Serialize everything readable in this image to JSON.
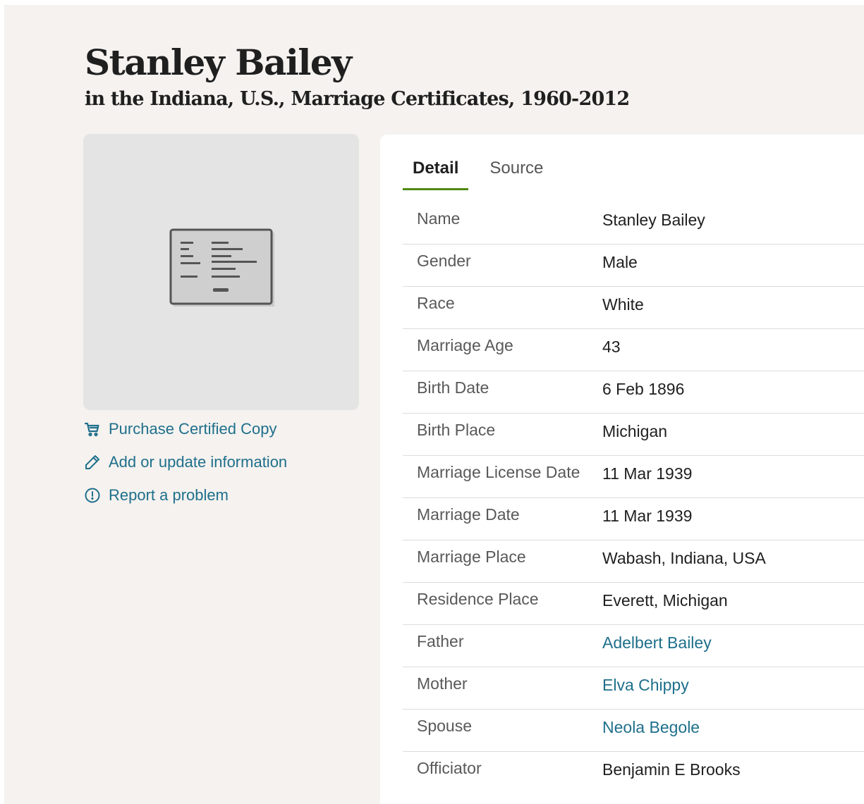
{
  "header": {
    "title": "Stanley Bailey",
    "subtitle": "in the Indiana, U.S., Marriage Certificates, 1960-2012"
  },
  "image_card": {
    "icon": "document-icon"
  },
  "actions": [
    {
      "icon": "cart-icon",
      "label": "Purchase Certified Copy"
    },
    {
      "icon": "pencil-icon",
      "label": "Add or update information"
    },
    {
      "icon": "alert-circle-icon",
      "label": "Report a problem"
    }
  ],
  "tabs": [
    {
      "label": "Detail",
      "active": true
    },
    {
      "label": "Source",
      "active": false
    }
  ],
  "details": [
    {
      "label": "Name",
      "value": "Stanley Bailey",
      "link": false
    },
    {
      "label": "Gender",
      "value": "Male",
      "link": false
    },
    {
      "label": "Race",
      "value": "White",
      "link": false
    },
    {
      "label": "Marriage Age",
      "value": "43",
      "link": false
    },
    {
      "label": "Birth Date",
      "value": "6 Feb 1896",
      "link": false
    },
    {
      "label": "Birth Place",
      "value": "Michigan",
      "link": false
    },
    {
      "label": "Marriage License Date",
      "value": "11 Mar 1939",
      "link": false
    },
    {
      "label": "Marriage Date",
      "value": "11 Mar 1939",
      "link": false
    },
    {
      "label": "Marriage Place",
      "value": "Wabash, Indiana, USA",
      "link": false
    },
    {
      "label": "Residence Place",
      "value": "Everett, Michigan",
      "link": false
    },
    {
      "label": "Father",
      "value": "Adelbert Bailey",
      "link": true
    },
    {
      "label": "Mother",
      "value": "Elva Chippy",
      "link": true
    },
    {
      "label": "Spouse",
      "value": "Neola Begole",
      "link": true
    },
    {
      "label": "Officiator",
      "value": "Benjamin E Brooks",
      "link": false
    }
  ],
  "colors": {
    "page_bg": "#f5f2ef",
    "link": "#1f6f8b",
    "tab_underline": "#4f8a10"
  }
}
